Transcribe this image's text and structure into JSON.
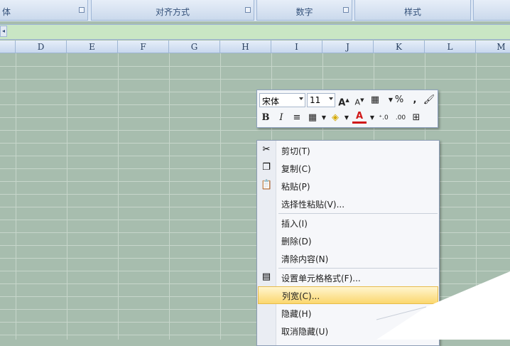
{
  "ribbon": {
    "groups": [
      {
        "label": "体"
      },
      {
        "label": "对齐方式"
      },
      {
        "label": "数字"
      },
      {
        "label": "样式"
      }
    ]
  },
  "sheet": {
    "columns": [
      "D",
      "E",
      "F",
      "G",
      "H",
      "I",
      "J",
      "K",
      "L",
      "M"
    ]
  },
  "mini_toolbar": {
    "font_name": "宋体",
    "font_size": "11",
    "percent": "%",
    "comma": ",",
    "bold": "B",
    "italic": "I",
    "font_color_label": "A"
  },
  "context_menu": {
    "items": [
      {
        "label": "剪切(T)",
        "icon": "scissors-icon"
      },
      {
        "label": "复制(C)",
        "icon": "copy-icon"
      },
      {
        "label": "粘贴(P)",
        "icon": "paste-icon"
      },
      {
        "label": "选择性粘贴(V)..."
      },
      {
        "label": "插入(I)"
      },
      {
        "label": "删除(D)"
      },
      {
        "label": "清除内容(N)"
      },
      {
        "label": "设置单元格格式(F)...",
        "icon": "format-cells-icon"
      },
      {
        "label": "列宽(C)..."
      },
      {
        "label": "隐藏(H)"
      },
      {
        "label": "取消隐藏(U)"
      }
    ]
  },
  "colors": {
    "grid_bg": "#a7bdae",
    "highlight": "#fbd76e",
    "ribbon_text": "#34517a"
  }
}
